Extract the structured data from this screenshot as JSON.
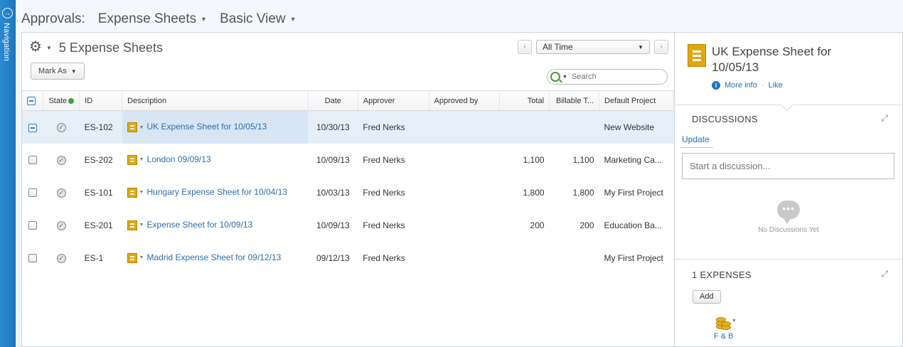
{
  "nav": {
    "label": "Navigation"
  },
  "breadcrumb": {
    "root": "Approvals:",
    "module": "Expense Sheets",
    "view": "Basic View"
  },
  "list": {
    "title": "5 Expense Sheets",
    "time_filter": "All Time",
    "mark_as_label": "Mark As",
    "search_placeholder": "Search",
    "columns": [
      "State",
      "ID",
      "Description",
      "Date",
      "Approver",
      "Approved by",
      "Total",
      "Billable T...",
      "Default Project"
    ],
    "rows": [
      {
        "id": "ES-102",
        "description": "UK Expense Sheet for 10/05/13",
        "date": "10/30/13",
        "approver": "Fred Nerks",
        "approved_by": "",
        "total": "",
        "billable": "",
        "project": "New Website",
        "selected": true
      },
      {
        "id": "ES-202",
        "description": "London 09/09/13",
        "date": "10/09/13",
        "approver": "Fred Nerks",
        "approved_by": "",
        "total": "1,100",
        "billable": "1,100",
        "project": "Marketing Ca...",
        "selected": false
      },
      {
        "id": "ES-101",
        "description": "Hungary Expense Sheet for 10/04/13",
        "date": "10/03/13",
        "approver": "Fred Nerks",
        "approved_by": "",
        "total": "1,800",
        "billable": "1,800",
        "project": "My First Project",
        "selected": false
      },
      {
        "id": "ES-201",
        "description": "Expense Sheet for 10/09/13",
        "date": "10/09/13",
        "approver": "Fred Nerks",
        "approved_by": "",
        "total": "200",
        "billable": "200",
        "project": "Education Ba...",
        "selected": false
      },
      {
        "id": "ES-1",
        "description": "Madrid Expense Sheet for 09/12/13",
        "date": "09/12/13",
        "approver": "Fred Nerks",
        "approved_by": "",
        "total": "",
        "billable": "",
        "project": "My First Project",
        "selected": false
      }
    ]
  },
  "detail": {
    "title": "UK Expense Sheet for 10/05/13",
    "more_info": "More info",
    "separator": "·",
    "like": "Like",
    "discussions_title": "DISCUSSIONS",
    "update_link": "Update",
    "discussion_placeholder": "Start a discussion...",
    "no_discussions": "No Discussions Yet",
    "expenses_title": "1 EXPENSES",
    "add_label": "Add",
    "expense_item": "F & B"
  },
  "colors": {
    "nav_blue": "#1f77bd",
    "link": "#2a6fae",
    "doc_icon": "#e2a60d",
    "selected_row": "#e6eff8",
    "state_ok": "#3aa535"
  }
}
